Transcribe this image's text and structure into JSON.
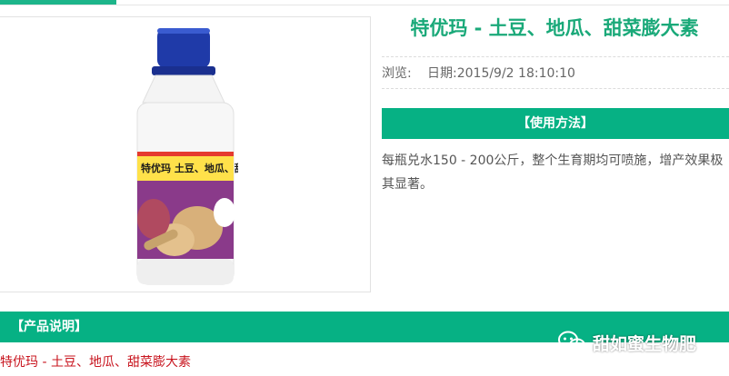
{
  "product": {
    "title": "特优玛 - 土豆、地瓜、甜菜膨大素",
    "views_label": "浏览:",
    "date_text": "日期:2015/9/2 18:10:10",
    "label_title": "特优玛 土豆、地瓜、甜菜膨大素"
  },
  "usage": {
    "header": "【使用方法】",
    "text": "每瓶兑水150 - 200公斤，整个生育期均可喷施，增产效果极其显著。"
  },
  "description": {
    "header": "【产品说明】",
    "text": "特优玛 - 土豆、地瓜、甜菜膨大素"
  },
  "watermark": {
    "text": "甜如蜜生物肥",
    "icon": "wechat-icon"
  },
  "colors": {
    "accent": "#06b184",
    "title": "#1aa979",
    "desc_text": "#c8141e"
  }
}
